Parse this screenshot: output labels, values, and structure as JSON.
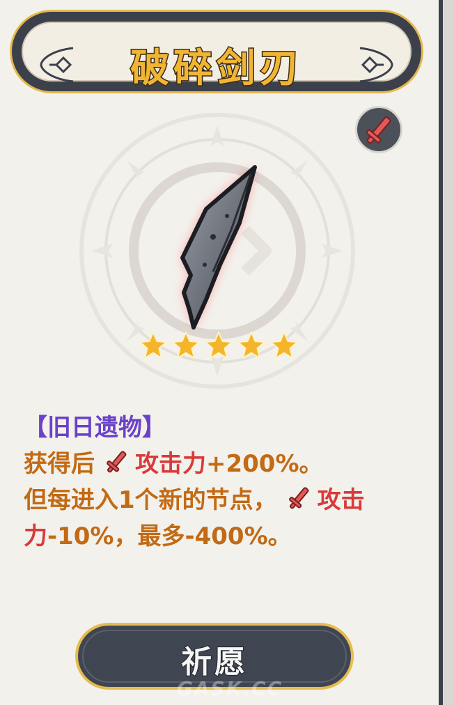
{
  "item": {
    "title": "破碎剑刃",
    "stars": 5,
    "star_color": "#f5b52a",
    "category_label": "【旧日遗物】",
    "description_line1_prefix": "获得后",
    "stat_name": "攻击力",
    "description_line1_suffix": "+200%。",
    "description_line2_prefix": "但每进入1个新的节点，",
    "stat_name_split_a": "攻击",
    "stat_name_split_b": "力",
    "description_line3_suffix": "-10%，最多-400%。",
    "stat_icon": "sword-icon",
    "type_badge_icon": "sword-icon"
  },
  "actions": {
    "wish_label": "祈愿"
  },
  "watermark": "GASK.CC",
  "colors": {
    "accent_gold": "#e6bc4e",
    "attack_red": "#d83a3a",
    "category_purple": "#6a42c8",
    "text_orange": "#c26a14",
    "button_dark": "#3f4652"
  }
}
